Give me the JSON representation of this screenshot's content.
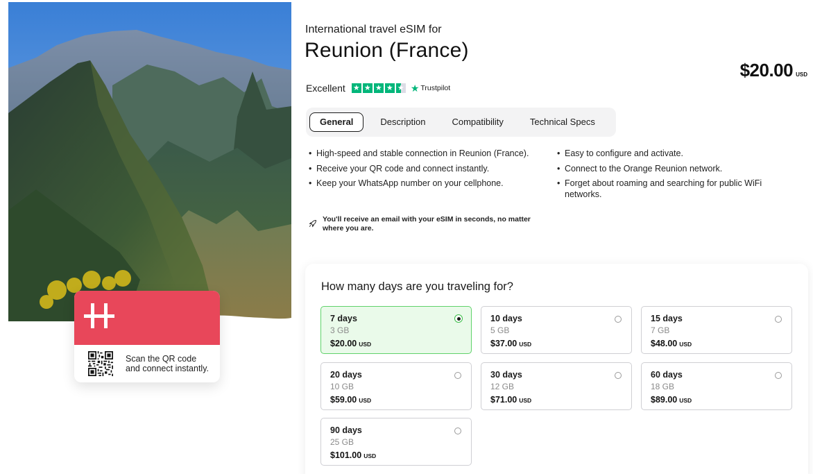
{
  "hero": {
    "card_text": "Scan the QR code and connect instantly."
  },
  "header": {
    "subtitle": "International travel eSIM for",
    "title": "Reunion (France)",
    "price": "$20.00",
    "currency": "USD"
  },
  "rating": {
    "label": "Excellent",
    "stars": 4.5,
    "provider": "Trustpilot",
    "color": "#00b67a"
  },
  "tabs": [
    {
      "label": "General",
      "active": true
    },
    {
      "label": "Description",
      "active": false
    },
    {
      "label": "Compatibility",
      "active": false
    },
    {
      "label": "Technical Specs",
      "active": false
    }
  ],
  "features": {
    "col1": [
      "High-speed and stable connection in Reunion (France).",
      "Receive your QR code and connect instantly.",
      "Keep your WhatsApp number on your cellphone."
    ],
    "col2": [
      "Easy to configure and activate.",
      "Connect to the Orange Reunion network.",
      "Forget about roaming and searching for public WiFi networks."
    ]
  },
  "note": {
    "icon": "rocket-icon",
    "text": "You'll receive an email with your eSIM in seconds, no matter where you are."
  },
  "plans": {
    "question": "How many days are you traveling for?",
    "items": [
      {
        "days": "7 days",
        "data": "3 GB",
        "price": "$20.00",
        "currency": "USD",
        "selected": true
      },
      {
        "days": "10 days",
        "data": "5 GB",
        "price": "$37.00",
        "currency": "USD",
        "selected": false
      },
      {
        "days": "15 days",
        "data": "7 GB",
        "price": "$48.00",
        "currency": "USD",
        "selected": false
      },
      {
        "days": "20 days",
        "data": "10 GB",
        "price": "$59.00",
        "currency": "USD",
        "selected": false
      },
      {
        "days": "30 days",
        "data": "12 GB",
        "price": "$71.00",
        "currency": "USD",
        "selected": false
      },
      {
        "days": "60 days",
        "data": "18 GB",
        "price": "$89.00",
        "currency": "USD",
        "selected": false
      },
      {
        "days": "90 days",
        "data": "25 GB",
        "price": "$101.00",
        "currency": "USD",
        "selected": false
      }
    ]
  },
  "colors": {
    "accent": "#e8475a",
    "selected_bg": "#eafaea",
    "selected_border": "#5fd26a"
  }
}
